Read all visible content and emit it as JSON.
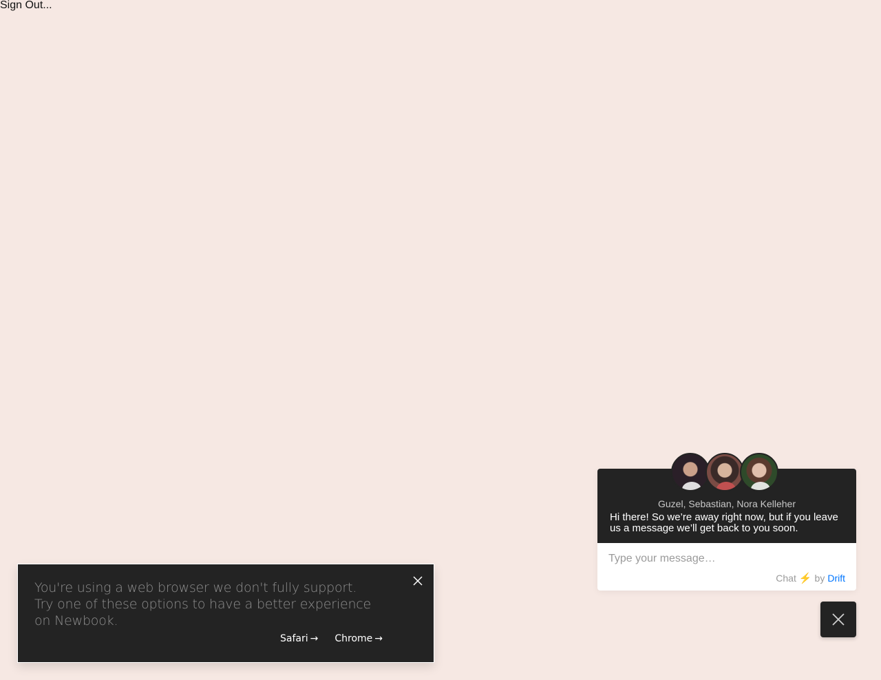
{
  "page": {
    "signout_text": "Sign Out..."
  },
  "browser_notice": {
    "message": "You're using a web browser we don't fully support. Try one of these options to have a better experience on Newbook.",
    "links": [
      {
        "label": "Safari",
        "icon": "arrow-right-icon"
      },
      {
        "label": "Chrome",
        "icon": "arrow-right-icon"
      }
    ],
    "close_icon": "close-icon"
  },
  "chat": {
    "agents": "Guzel, Sebastian, Nora Kelleher",
    "greeting": "Hi there! So we’re away right now, but if you leave us a message we’ll get back to you soon.",
    "input_placeholder": "Type your message…",
    "powered_prefix": "Chat",
    "powered_by": "by",
    "powered_brand": "Drift",
    "toggle_icon": "close-icon"
  },
  "colors": {
    "background": "#f6e8e3",
    "dark_panel": "#232323",
    "drift_blue": "#0176ff",
    "bolt_yellow": "#f5b400"
  }
}
